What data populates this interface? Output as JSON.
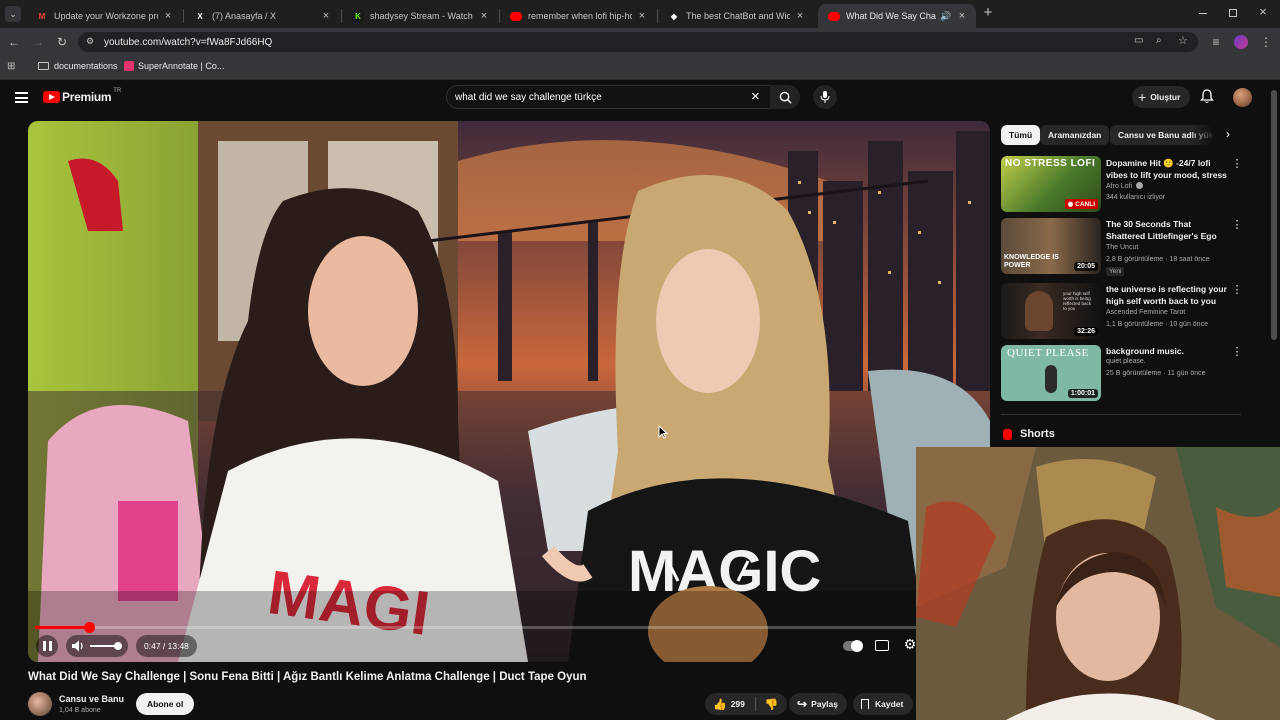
{
  "browser": {
    "tabs": [
      {
        "title": "Update your Workzone profile",
        "favicon": "gmail-icon",
        "color": "#ea4335"
      },
      {
        "title": "(7) Anasayfa / X",
        "favicon": "x-icon",
        "color": "#ffffff"
      },
      {
        "title": "shadysey Stream - Watch Live on",
        "favicon": "kick-icon",
        "color": "#53fc18"
      },
      {
        "title": "remember when lofi hip-hop w",
        "favicon": "youtube-icon",
        "color": "#ff0000"
      },
      {
        "title": "The best ChatBot and Widgets",
        "favicon": "chatbot-icon",
        "color": "#ffffff"
      },
      {
        "title": "What Did We Say Challeng",
        "favicon": "youtube-icon",
        "color": "#ff0000"
      }
    ],
    "url": "youtube.com/watch?v=fWa8FJd66HQ",
    "bookmarks": [
      {
        "label": "documentations",
        "icon": "folder-icon"
      },
      {
        "label": "SuperAnnotate | Co...",
        "icon": "superannotate-icon"
      }
    ]
  },
  "youtube": {
    "logo_text": "Premium",
    "logo_badge": "TR",
    "search_value": "what did we say challenge türkçe",
    "create_label": "Oluştur",
    "accent": "#ff0000"
  },
  "video": {
    "title": "What Did We Say Challenge | Sonu Fena Bitti | Ağız Bantlı Kelime Anlatma Challenge | Duct Tape Oyun",
    "time": "0:47 / 13:48",
    "progress": 0.057,
    "channel": "Cansu ve Banu",
    "subscribers": "1,04 B abone",
    "subscribe_label": "Abone ol",
    "likes": "299",
    "share_label": "Paylaş",
    "save_label": "Kaydet"
  },
  "chips": [
    "Tümü",
    "Aramanızdan",
    "Cansu ve Banu adlı yükle"
  ],
  "recommendations": [
    {
      "title": "Dopamine Hit 🙂 -24/7 lofi vibes to lift your mood, stress ...",
      "channel": "Afro Lofi",
      "meta": "344 kullanıcı izliyor",
      "badge": "CANLI",
      "thumb_text": "NO STRESS LOFI"
    },
    {
      "title": "The 30 Seconds That Shattered Littlefinger's Ego",
      "channel": "The Uncut",
      "meta": "2,8 B görüntüleme · 18 saat önce",
      "tag": "Yeni",
      "duration": "20:05",
      "thumb_text": "KNOWLEDGE IS POWER"
    },
    {
      "title": "the universe is reflecting your high self worth back to you",
      "channel": "Ascended Feminine Tarot",
      "meta": "1,1 B görüntüleme · 10 gün önce",
      "duration": "32:26"
    },
    {
      "title": "background music.",
      "channel": "quiet please.",
      "meta": "25 B görüntüleme · 11 gün önce",
      "duration": "1:00:01",
      "thumb_text": "QUIET PLEASE"
    }
  ],
  "shorts_label": "Shorts"
}
